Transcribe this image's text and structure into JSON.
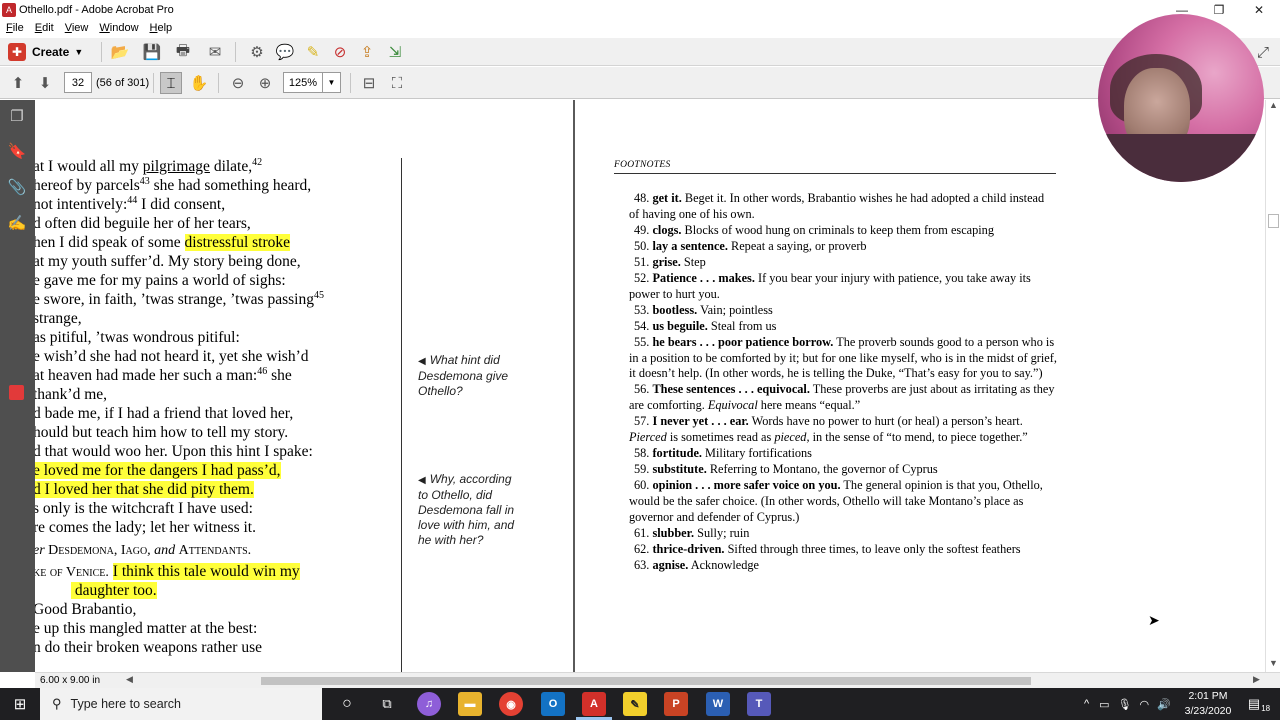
{
  "window": {
    "title": "Othello.pdf - Adobe Acrobat Pro",
    "controls": {
      "minimize": "—",
      "restore": "❐",
      "close": "✕"
    }
  },
  "menu": [
    "File",
    "Edit",
    "View",
    "Window",
    "Help"
  ],
  "toolbar": {
    "create_label": "Create",
    "page_number": "32",
    "page_count": "(56 of 301)",
    "zoom": "125%"
  },
  "left_page": {
    "lines": [
      {
        "pre": "at I would all my ",
        "u": "pilgrimage",
        "post": " dilate,",
        "sup": "42"
      },
      {
        "pre": "hereof by parcels",
        "sup": "43",
        "post": " she had something heard,"
      },
      {
        "pre": " not intentively:",
        "sup": "44",
        "post": " I did consent,"
      },
      {
        "pre": "d often did beguile her of her tears,"
      },
      {
        "pre": "hen I did speak of some ",
        "hl": "distressful stroke"
      },
      {
        "pre": "at my youth suffer’d. My story being done,"
      },
      {
        "pre": "e gave me for my pains a world of sighs:"
      },
      {
        "pre": "e swore, in faith, ’twas strange, ’twas passing",
        "sup": "45"
      },
      {
        "pre": " strange,"
      },
      {
        "pre": "as pitiful, ’twas wondrous pitiful:"
      },
      {
        "pre": "e wish’d she had not heard it, yet she wish’d"
      },
      {
        "pre": "at heaven had made her such a man:",
        "sup": "46",
        "post": " she"
      },
      {
        "pre": " thank’d me,"
      },
      {
        "pre": "d bade me, if I had a friend that loved her,"
      },
      {
        "pre": "hould but teach him how to tell my story."
      },
      {
        "pre": "d that would woo her. Upon this hint I spake:"
      },
      {
        "hl": "e loved me for the dangers I had pass’d,"
      },
      {
        "hl": "d I loved her that she did pity them."
      },
      {
        "pre": "s only is the witchcraft I have used:"
      },
      {
        "pre": "re comes the lady; let her witness it."
      }
    ],
    "stage_direction": {
      "pre": "er ",
      "name1": "Desdemona",
      "sep1": ", ",
      "name2": "Iago",
      "and": ", and ",
      "name3": "Attendants",
      "end": "."
    },
    "duke_speech": {
      "speaker": "ke of Venice.",
      "hl1": " I think this tale would win my",
      "hl2": " daughter too."
    },
    "tail_lines": [
      " Good Brabantio,",
      "e up this mangled matter at the best:",
      "n do their broken weapons rather use"
    ],
    "notes": [
      {
        "lines": [
          "What hint did",
          "Desdemona give",
          "Othello?"
        ]
      },
      {
        "lines": [
          "Why, according",
          "to Othello, did",
          "Desdemona fall in",
          "love with him, and",
          "he with her?"
        ]
      }
    ]
  },
  "footnotes": {
    "heading": "FOOTNOTES",
    "items": [
      {
        "n": "48.",
        "term": "get it.",
        "text": " Beget it. In other words, Brabantio wishes he had adopted a child instead of having one of his own."
      },
      {
        "n": "49.",
        "term": "clogs.",
        "text": " Blocks of wood hung on criminals to keep them from escaping"
      },
      {
        "n": "50.",
        "term": "lay a sentence.",
        "text": " Repeat a saying, or proverb"
      },
      {
        "n": "51.",
        "term": "grise.",
        "text": " Step"
      },
      {
        "n": "52.",
        "term": "Patience . . . makes.",
        "text": " If you bear your injury with patience, you take away its power to hurt you."
      },
      {
        "n": "53.",
        "term": "bootless.",
        "text": " Vain; pointless"
      },
      {
        "n": "54.",
        "term": "us beguile.",
        "text": " Steal from us"
      },
      {
        "n": "55.",
        "term": "he bears . . . poor patience borrow.",
        "text": " The proverb sounds good to a person who is in a position to be comforted by it; but for one like myself, who is in the midst of grief, it doesn’t help. (In other words, he is telling the Duke, “That’s easy for you to say.”)"
      },
      {
        "n": "56.",
        "term": "These sentences . . . equivocal.",
        "text": " These proverbs are just about as irritating as they are comforting. ",
        "em": "Equivocal",
        "text2": " here means “equal.”"
      },
      {
        "n": "57.",
        "term": "I never yet . . . ear.",
        "text": " Words have no power to hurt (or heal) a person’s heart. ",
        "em": "Pierced",
        "text2": " is sometimes read as ",
        "em2": "pieced,",
        "text3": " in the sense of “to mend, to piece together.”"
      },
      {
        "n": "58.",
        "term": "fortitude.",
        "text": " Military fortifications"
      },
      {
        "n": "59.",
        "term": "substitute.",
        "text": " Referring to Montano, the governor of Cyprus"
      },
      {
        "n": "60.",
        "term": "opinion . . . more safer voice on you.",
        "text": " The general opinion is that you, Othello, would be the safer choice. (In other words, Othello will take Montano’s place as governor and defender of Cyprus.)"
      },
      {
        "n": "61.",
        "term": "slubber.",
        "text": " Sully; ruin"
      },
      {
        "n": "62.",
        "term": "thrice-driven.",
        "text": " Sifted through three times, to leave only the softest feathers"
      },
      {
        "n": "63.",
        "term": "agnise.",
        "text": " Acknowledge"
      }
    ]
  },
  "status": {
    "page_size": "6.00 x 9.00 in"
  },
  "taskbar": {
    "search_placeholder": "Type here to search",
    "time": "2:01 PM",
    "date": "3/23/2020",
    "notification_count": "18"
  },
  "colors": {
    "highlight": "#ffff3a",
    "rail": "#4f4f4f",
    "taskbar": "#1f1f22"
  }
}
